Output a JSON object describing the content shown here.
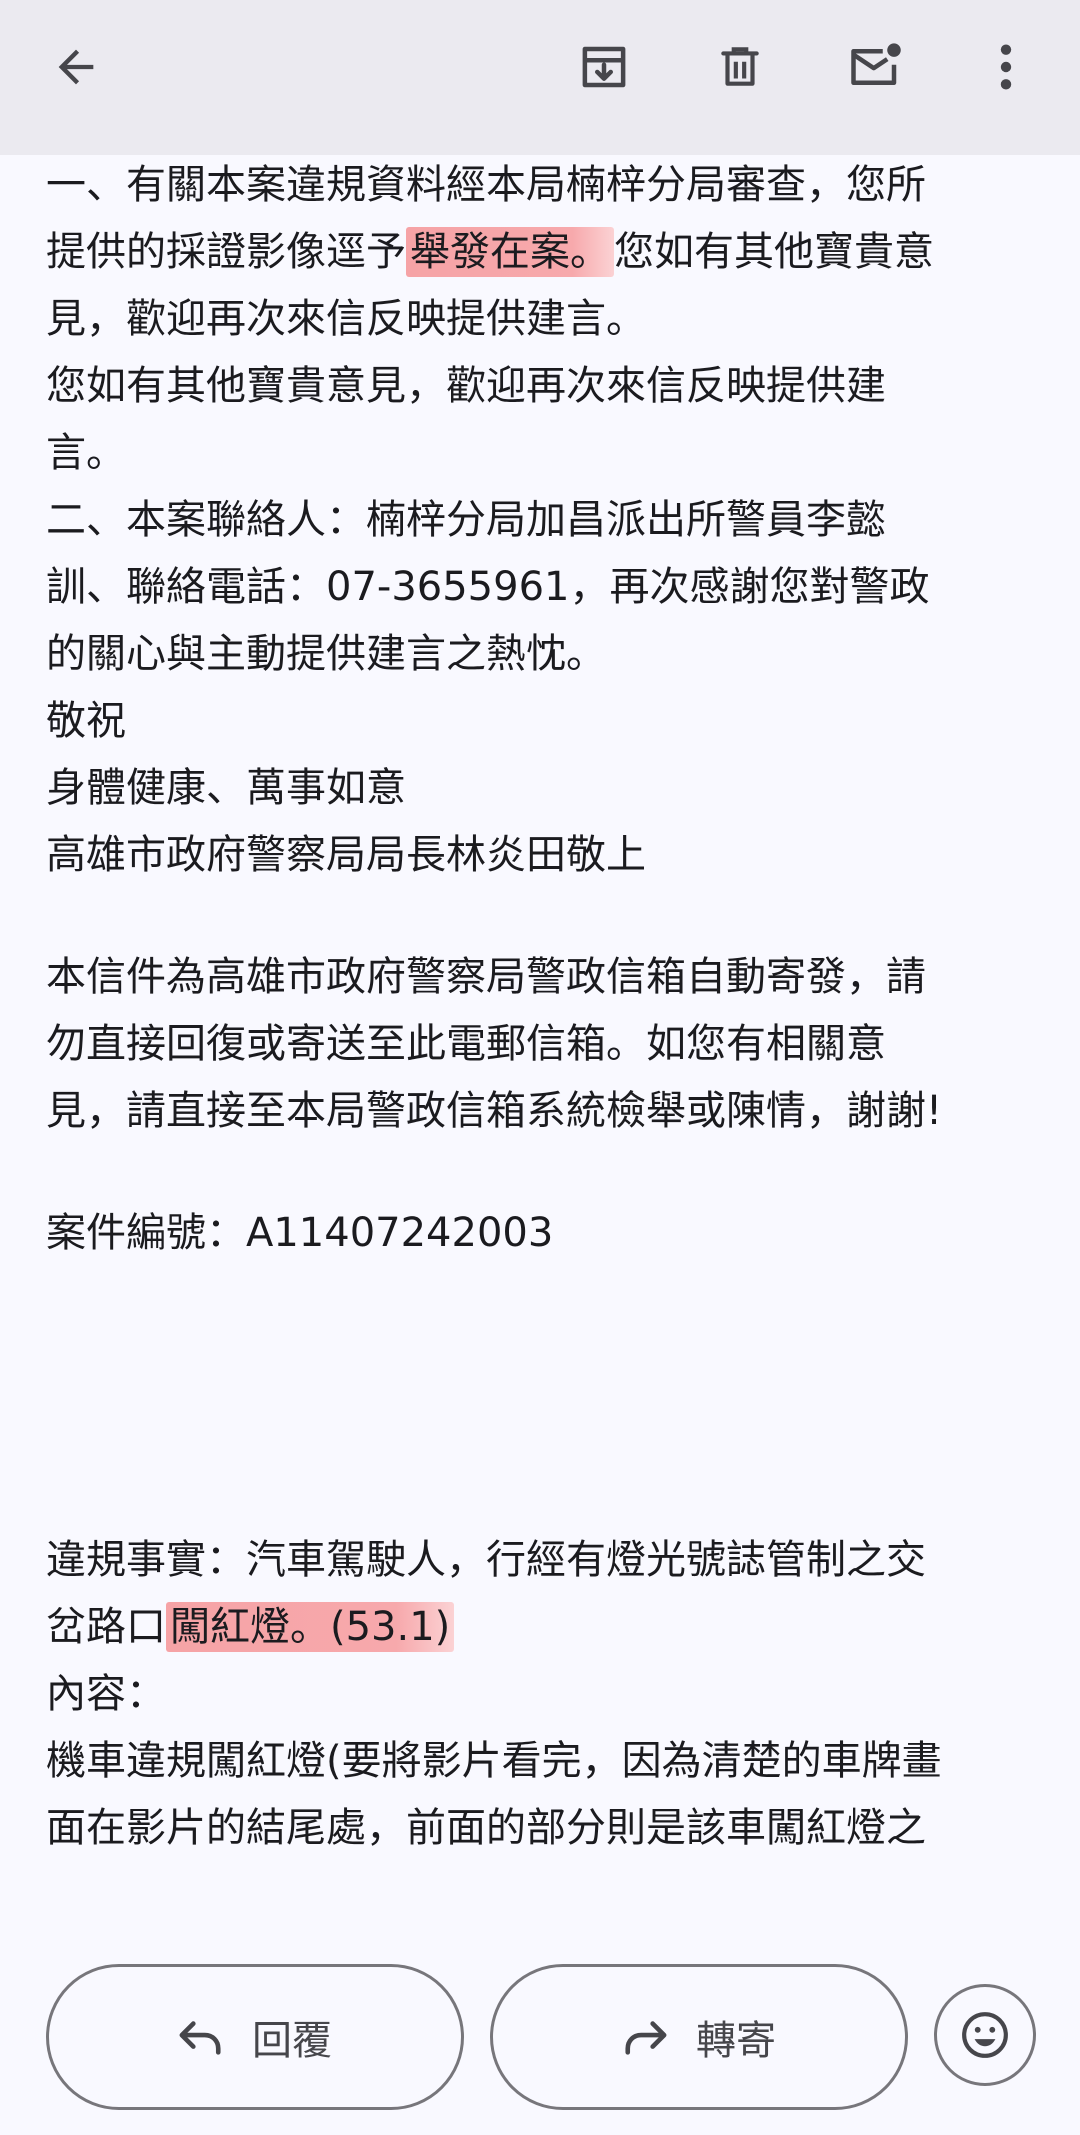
{
  "toolbar": {
    "back_icon": "arrow-left-icon",
    "archive_icon": "archive-icon",
    "delete_icon": "trash-icon",
    "mark_unread_icon": "mail-unread-icon",
    "more_icon": "more-vert-icon"
  },
  "body": {
    "p1_l1": "一、有關本案違規資料經本局楠梓分局審查，您所",
    "p1_l2_a": "提供的採證影像逕予",
    "p1_l2_hl": "舉發在案。",
    "p1_l2_b": "您如有其他寶貴意",
    "p1_l3": "見，歡迎再次來信反映提供建言。",
    "p2_l1": "您如有其他寶貴意見，歡迎再次來信反映提供建",
    "p2_l2": "言。",
    "p3_l1": "二、本案聯絡人：楠梓分局加昌派出所警員李懿",
    "p3_l2": "訓、聯絡電話：07-3655961，再次感謝您對警政",
    "p3_l3": "的關心與主動提供建言之熱忱。",
    "greet1": "敬祝",
    "greet2": "身體健康、萬事如意",
    "signature": "高雄市政府警察局局長林炎田敬上",
    "notice_l1": "本信件為高雄市政府警察局警政信箱自動寄發，請",
    "notice_l2": "勿直接回復或寄送至此電郵信箱。如您有相關意",
    "notice_l3": "見，請直接至本局警政信箱系統檢舉或陳情，謝謝!",
    "case_no": "案件編號：A11407242003",
    "violation_l1": "違規事實：汽車駕駛人，行經有燈光號誌管制之交",
    "violation_l2_a": "岔路口",
    "violation_l2_hl": "闖紅燈。(53.1)",
    "content_label": "內容：",
    "content_l1": "機車違規闖紅燈(要將影片看完，因為清楚的車牌畫",
    "content_l2": "面在影片的結尾處，前面的部分則是該車闖紅燈之"
  },
  "actions": {
    "reply_label": "回覆",
    "reply_icon": "reply-icon",
    "forward_label": "轉寄",
    "forward_icon": "forward-icon",
    "emoji_icon": "emoji-reaction-icon"
  },
  "colors": {
    "highlight": "#f6a3a6",
    "toolbar_bg": "#ebeaf0",
    "page_bg": "#f9f9ff"
  }
}
